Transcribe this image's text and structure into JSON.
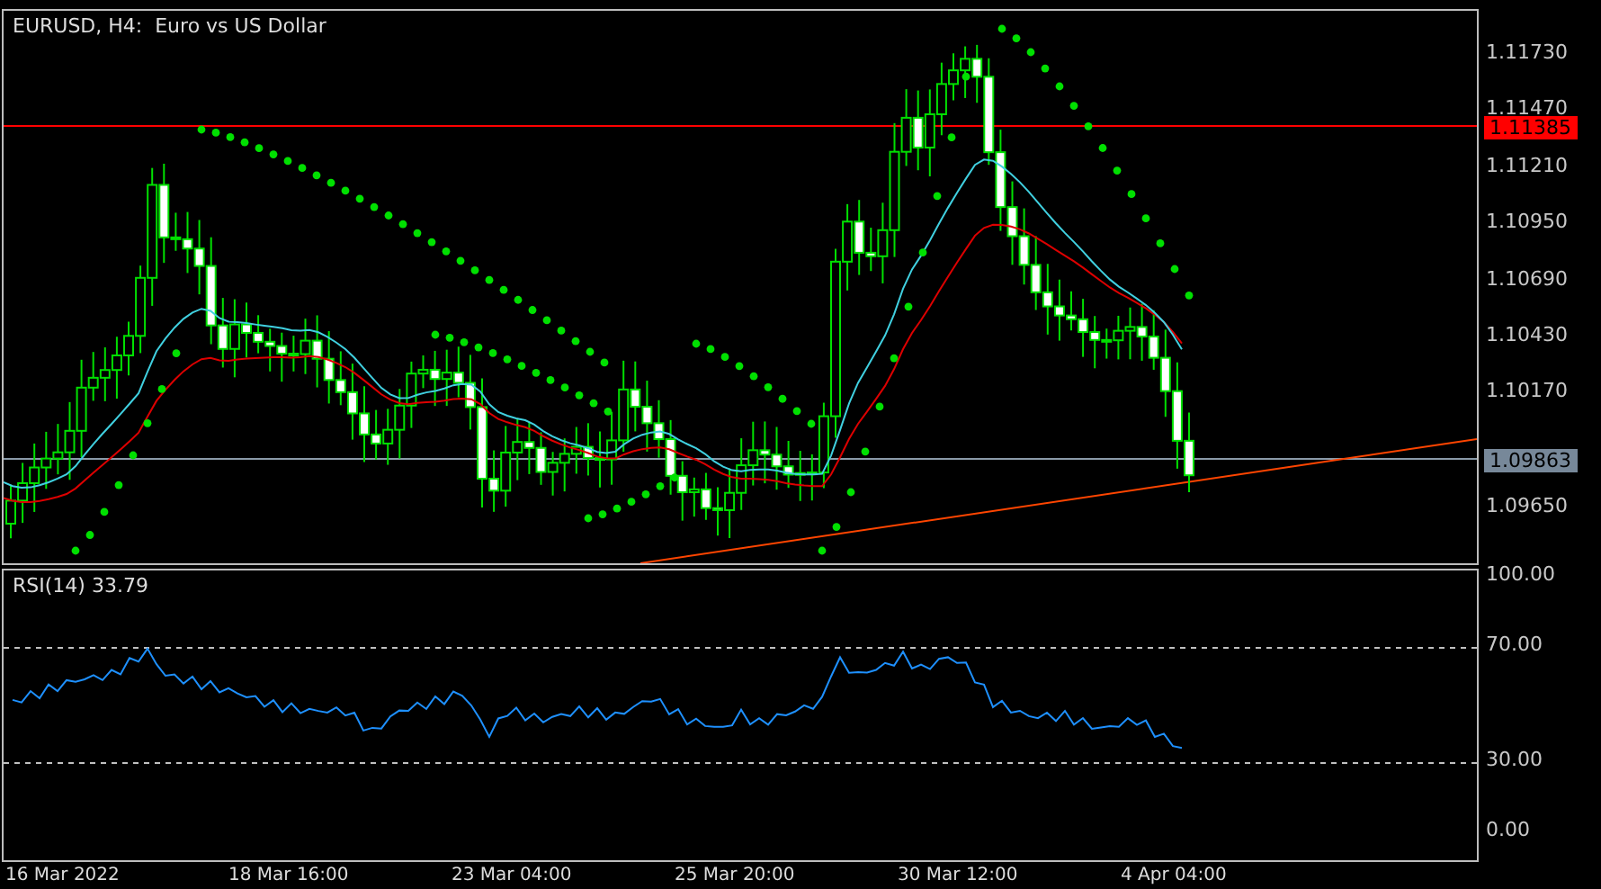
{
  "chart": {
    "title": "EURUSD, H4:  Euro vs US Dollar",
    "price_ticks": [
      "1.11730",
      "1.11470",
      "1.11210",
      "1.10950",
      "1.10690",
      "1.10430",
      "1.10170",
      "1.09650"
    ],
    "level_line_label": "1.11385",
    "current_price_label": "1.09863"
  },
  "rsi": {
    "title": "RSI(14) 33.79",
    "ticks": [
      "100.00",
      "70.00",
      "30.00",
      "0.00"
    ]
  },
  "time_axis": [
    "16 Mar 2022",
    "18 Mar 16:00",
    "23 Mar 04:00",
    "25 Mar 20:00",
    "30 Mar 12:00",
    "4 Apr 04:00"
  ]
}
